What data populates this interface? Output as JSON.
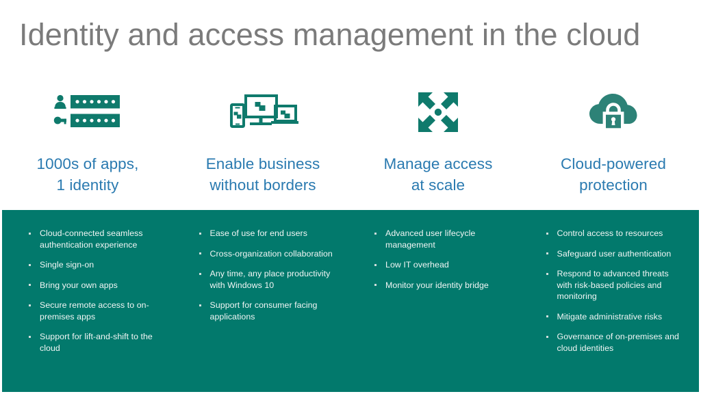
{
  "slide": {
    "title": "Identity and access management in the cloud",
    "theme": {
      "title_color": "#7b7b7b",
      "heading_color": "#2a7ab0",
      "panel_color": "#02796c",
      "icon_color": "#0f7a6c",
      "bullet_text_color": "#f2f6f5",
      "background_color": "#ffffff"
    }
  },
  "columns": [
    {
      "icon": "credentials-user-password-icon",
      "heading": "1000s of apps,\n1 identity",
      "heading_line1": "1000s of apps,",
      "heading_line2": "1 identity",
      "bullets": [
        "Cloud-connected seamless authentication experience",
        "Single sign-on",
        "Bring your own apps",
        "Secure remote access to on-premises apps",
        "Support for lift-and-shift to the cloud"
      ]
    },
    {
      "icon": "multi-device-icon",
      "heading": "Enable business\nwithout borders",
      "heading_line1": "Enable business",
      "heading_line2": "without borders",
      "bullets": [
        "Ease of use for end users",
        "Cross-organization collaboration",
        "Any time, any place productivity with Windows 10",
        "Support for consumer facing applications"
      ]
    },
    {
      "icon": "expand-arrows-scale-icon",
      "heading": "Manage access\nat scale",
      "heading_line1": "Manage access",
      "heading_line2": "at scale",
      "bullets": [
        "Advanced user lifecycle management",
        "Low IT overhead",
        "Monitor your identity bridge"
      ]
    },
    {
      "icon": "cloud-lock-icon",
      "heading": "Cloud-powered\nprotection",
      "heading_line1": "Cloud-powered",
      "heading_line2": "protection",
      "bullets": [
        "Control access to resources",
        "Safeguard user authentication",
        "Respond to advanced threats with risk-based policies and monitoring",
        "Mitigate administrative risks",
        "Governance of on-premises and cloud identities"
      ]
    }
  ]
}
